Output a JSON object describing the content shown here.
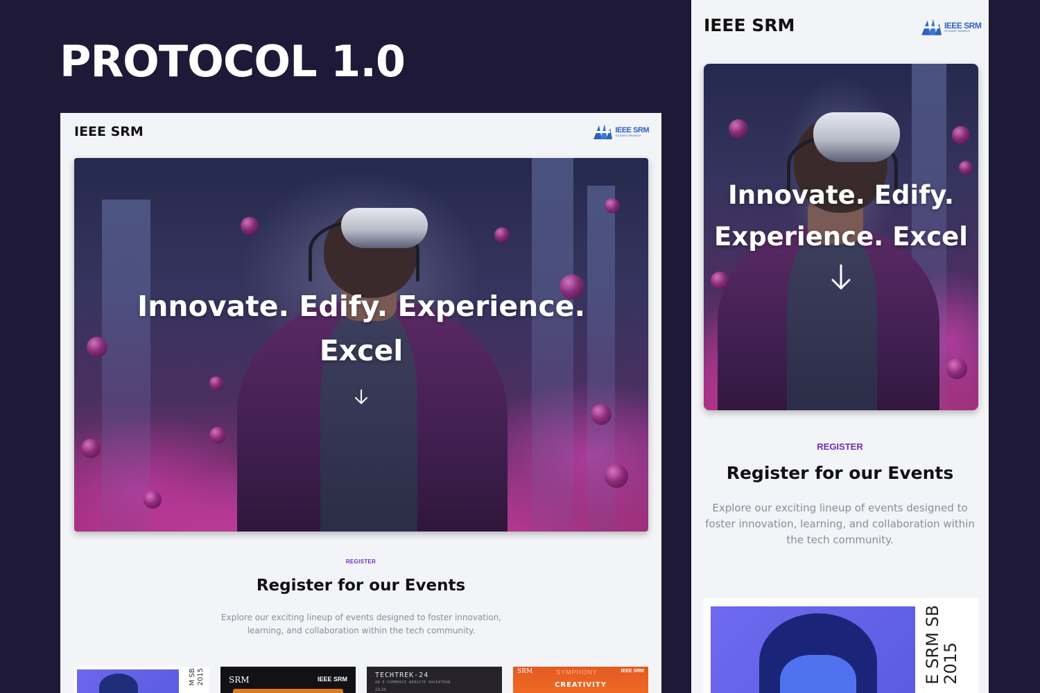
{
  "showcase": {
    "title": "PROTOCOL 1.0"
  },
  "desktop": {
    "brand": "IEEE SRM",
    "logo": {
      "main": "IEEE SRM",
      "sub": "STUDENT BRANCH"
    },
    "hero": {
      "line1": "Innovate. Edify. Experience.",
      "line2": "Excel"
    },
    "section": {
      "eyebrow": "REGISTER",
      "title": "Register for our Events",
      "description": "Explore our exciting lineup of events designed to foster innovation, learning, and collaboration within the tech community."
    },
    "cards": [
      {
        "side_line1": "M SB",
        "side_line2": "2015"
      },
      {
        "srm": "SRM",
        "ieee": "IEEE SRM"
      },
      {
        "title": "TECHTREK-24",
        "subtitle": "AN E-COMMERCE WEBSITE HACKATHON",
        "date": "23-24"
      },
      {
        "srm": "SRM",
        "symphony": "SYMPHONY",
        "ieee": "IEEE SRM",
        "creativity": "CREATIVITY"
      }
    ]
  },
  "mobile": {
    "brand": "IEEE SRM",
    "logo": {
      "main": "IEEE SRM",
      "sub": "STUDENT BRANCH"
    },
    "hero": {
      "line1": "Innovate. Edify.",
      "line2": "Experience. Excel"
    },
    "section": {
      "eyebrow": "REGISTER",
      "title": "Register for our Events",
      "description": "Explore our exciting lineup of events designed to foster innovation, learning, and collaboration within the tech community."
    },
    "card": {
      "side_line1": "E SRM SB",
      "side_line2": "2015"
    }
  },
  "icons": {
    "hero_arrow": "arrow-down-icon",
    "logo": "ieee-srm-logo"
  },
  "colors": {
    "background": "#1e1937",
    "accent": "#6b2fc0",
    "logo_blue": "#2f62c2"
  }
}
